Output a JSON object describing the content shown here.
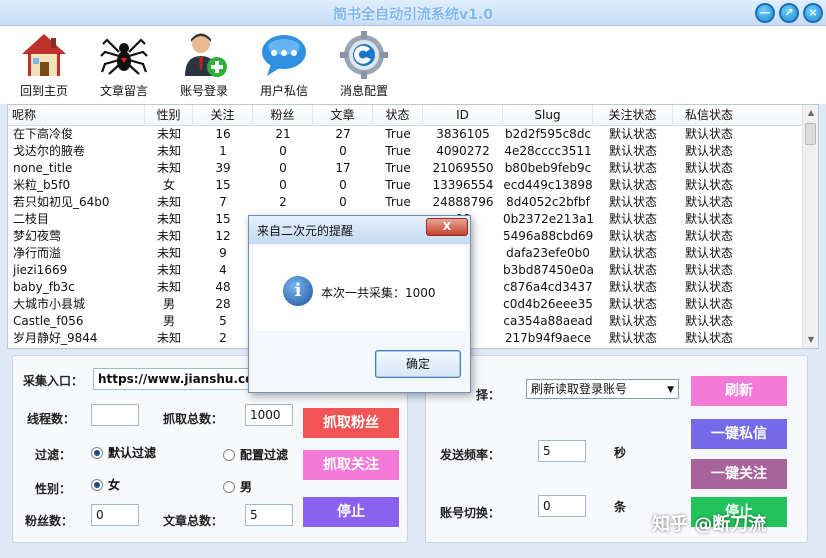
{
  "window": {
    "title": "简书全自动引流系统v1.0",
    "buttons": [
      "—",
      "↗",
      "×"
    ]
  },
  "toolbar": [
    {
      "label": "回到主页",
      "icon": "house-icon"
    },
    {
      "label": "文章留言",
      "icon": "spider-icon"
    },
    {
      "label": "账号登录",
      "icon": "user-add-icon"
    },
    {
      "label": "用户私信",
      "icon": "chat-bubble-icon"
    },
    {
      "label": "消息配置",
      "icon": "gear-icon"
    }
  ],
  "table": {
    "columns": [
      "呢称",
      "性别",
      "关注",
      "粉丝",
      "文章",
      "状态",
      "ID",
      "Slug",
      "关注状态",
      "私信状态"
    ],
    "rows": [
      [
        "在下高冷俊",
        "未知",
        "16",
        "21",
        "27",
        "True",
        "3836105",
        "b2d2f595c8dc",
        "默认状态",
        "默认状态"
      ],
      [
        "戈达尔的腋卷",
        "未知",
        "1",
        "0",
        "0",
        "True",
        "4090272",
        "4e28cccc3511",
        "默认状态",
        "默认状态"
      ],
      [
        "none_title",
        "未知",
        "39",
        "0",
        "17",
        "True",
        "21069550",
        "b80beb9feb9c",
        "默认状态",
        "默认状态"
      ],
      [
        "米粒_b5f0",
        "女",
        "15",
        "0",
        "0",
        "True",
        "13396554",
        "ecd449c13898",
        "默认状态",
        "默认状态"
      ],
      [
        "若只如初见_64b0",
        "未知",
        "7",
        "2",
        "0",
        "True",
        "24888796",
        "8d4052c2bfbf",
        "默认状态",
        "默认状态"
      ],
      [
        "二枝目",
        "未知",
        "15",
        "",
        "",
        "",
        "08",
        "0b2372e213a1",
        "默认状态",
        "默认状态"
      ],
      [
        "梦幻夜莺",
        "未知",
        "12",
        "",
        "",
        "",
        "10",
        "5496a88cbd69",
        "默认状态",
        "默认状态"
      ],
      [
        "净行而溢",
        "未知",
        "9",
        "",
        "",
        "",
        "47",
        "dafa23efe0b0",
        "默认状态",
        "默认状态"
      ],
      [
        "jiezi1669",
        "未知",
        "4",
        "",
        "",
        "",
        "68",
        "b3bd87450e0a",
        "默认状态",
        "默认状态"
      ],
      [
        "baby_fb3c",
        "未知",
        "48",
        "",
        "",
        "",
        "24",
        "c876a4cd3437",
        "默认状态",
        "默认状态"
      ],
      [
        "大城市小县城",
        "男",
        "28",
        "",
        "",
        "",
        "78",
        "c0d4b26eee35",
        "默认状态",
        "默认状态"
      ],
      [
        "Castle_f056",
        "男",
        "5",
        "",
        "",
        "",
        "73",
        "ca354a88aead",
        "默认状态",
        "默认状态"
      ],
      [
        "岁月静好_9844",
        "未知",
        "2",
        "",
        "",
        "",
        "24",
        "217b94f9aece",
        "默认状态",
        "默认状态"
      ]
    ]
  },
  "left_panel": {
    "entry_label": "采集入口：",
    "entry_value": "https://www.jianshu.com",
    "threads_label": "线程数：",
    "threads_value": "",
    "fetch_total_label": "抓取总数：",
    "fetch_total_value": "1000",
    "filter_label": "过滤：",
    "filter_default": "默认过滤",
    "filter_config": "配置过滤",
    "gender_label": "性别：",
    "gender_female": "女",
    "gender_male": "男",
    "fans_label": "粉丝数：",
    "fans_value": "0",
    "articles_label": "文章总数：",
    "articles_value": "5",
    "btn_fetch_fans": "抓取粉丝",
    "btn_fetch_follow": "抓取关注",
    "btn_stop": "停止"
  },
  "right_panel": {
    "select_label": "择：",
    "select_value": "刷新读取登录账号",
    "freq_label": "发送频率：",
    "freq_value": "5",
    "freq_unit": "秒",
    "switch_label": "账号切换：",
    "switch_value": "0",
    "switch_unit": "条",
    "btn_refresh": "刷新",
    "btn_msg": "一键私信",
    "btn_follow": "一键关注",
    "btn_stop": "停止"
  },
  "dialog": {
    "title": "来自二次元的提醒",
    "close": "X",
    "message": "本次一共采集：1000",
    "ok": "确定"
  },
  "watermark": "知乎 @断刀流",
  "colors": {
    "red_button": "#f05454",
    "pink_button": "#f37ad8",
    "purple_button": "#8a62f0",
    "blue_purple_button": "#7569e8",
    "mauve_button": "#a8639c",
    "green_button": "#22c35a"
  }
}
